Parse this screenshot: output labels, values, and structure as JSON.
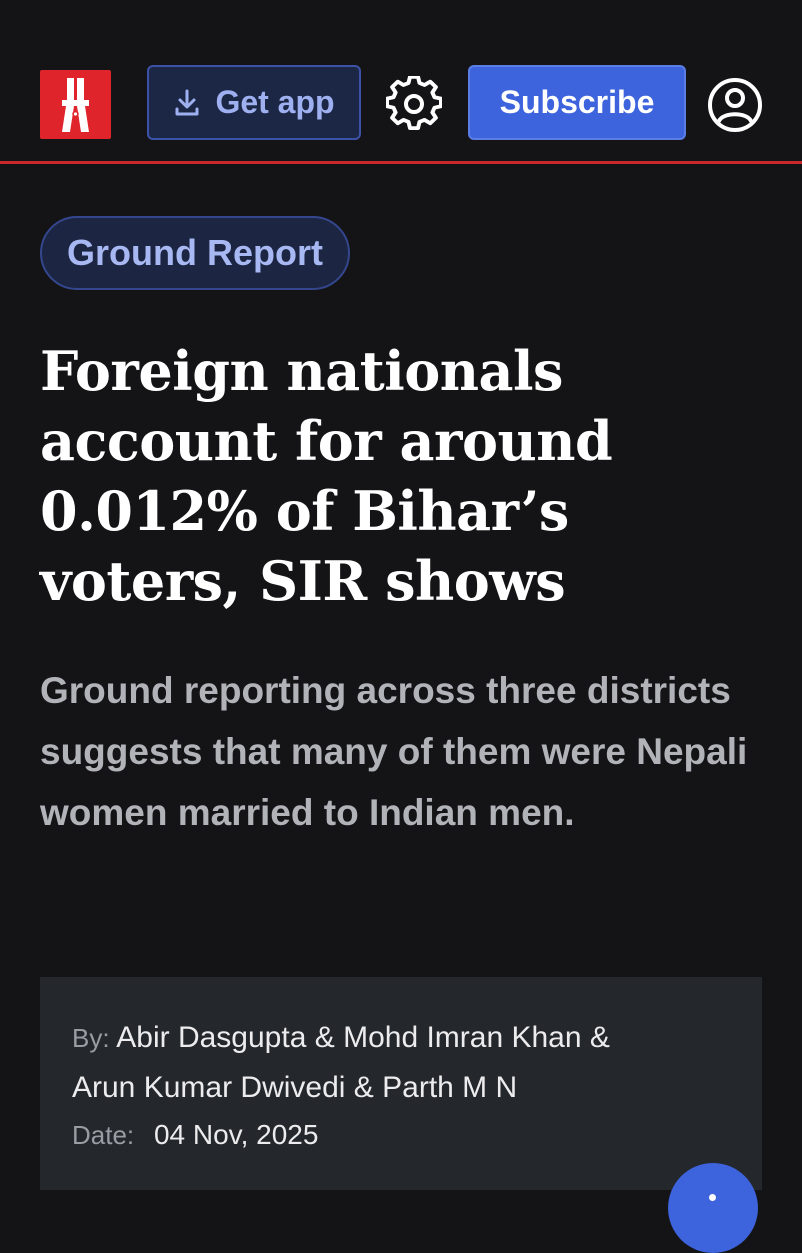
{
  "header": {
    "logo": {
      "icon": "clothespin-logo-icon",
      "color": "#e0242b"
    },
    "get_app": {
      "label": "Get app",
      "icon": "download-icon"
    },
    "settings": {
      "icon": "gear-icon"
    },
    "subscribe": {
      "label": "Subscribe",
      "color": "#3d63dd"
    },
    "account": {
      "icon": "user-account-icon"
    },
    "divider_color": "#c9282d"
  },
  "article": {
    "category": "Ground Report",
    "headline": "Foreign nationals account for around 0.012% of Bihar’s voters, SIR shows",
    "deck": "Ground reporting across three districts suggests that many of them were Nepali women married to Indian men.",
    "byline": {
      "label": "By:",
      "authors": [
        "Abir Dasgupta",
        "Mohd Imran Khan",
        "Arun Kumar Dwivedi",
        "Parth M N"
      ],
      "separator": "&"
    },
    "date": {
      "label": "Date:",
      "value": "04 Nov, 2025"
    }
  },
  "fab": {
    "icon": "more-options-icon"
  },
  "colors": {
    "background": "#141416",
    "accent": "#3d63dd",
    "pill_bg": "#1c2542",
    "pill_text": "#a8b8f3",
    "deck_text": "#b2b3b9",
    "byline_bg": "#24272b"
  }
}
